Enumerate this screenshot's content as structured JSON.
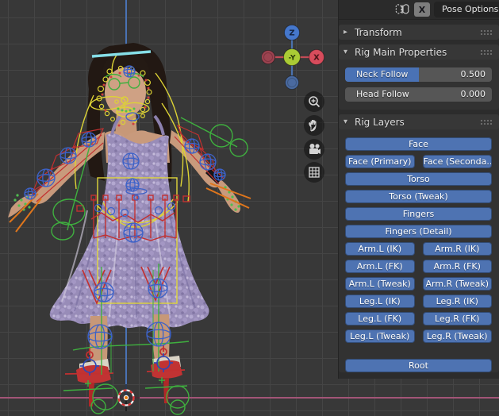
{
  "header": {
    "x_mirror_label": "X",
    "pose_options_label": "Pose Options"
  },
  "sidebar": {
    "panels": [
      {
        "label": "Transform",
        "collapsed": true
      },
      {
        "label": "Rig Main Properties",
        "collapsed": false
      },
      {
        "label": "Rig Layers",
        "collapsed": false
      }
    ],
    "sliders": [
      {
        "label": "Neck Follow",
        "value": "0.500",
        "fill_pct": 50
      },
      {
        "label": "Head Follow",
        "value": "0.000",
        "fill_pct": 0
      }
    ],
    "rig_layers": {
      "rows": [
        [
          "Face"
        ],
        [
          "Face (Primary)",
          "Face (Seconda..."
        ],
        [
          "Torso"
        ],
        [
          "Torso (Tweak)"
        ],
        [
          "Fingers"
        ],
        [
          "Fingers (Detail)"
        ],
        [
          "Arm.L (IK)",
          "Arm.R (IK)"
        ],
        [
          "Arm.L (FK)",
          "Arm.R (FK)"
        ],
        [
          "Arm.L (Tweak)",
          "Arm.R (Tweak)"
        ],
        [
          "Leg.L (IK)",
          "Leg.R (IK)"
        ],
        [
          "Leg.L (FK)",
          "Leg.R (FK)"
        ],
        [
          "Leg.L (Tweak)",
          "Leg.R (Tweak)"
        ]
      ],
      "root_label": "Root"
    }
  },
  "viewport": {
    "axis_gizmo": {
      "z_label": "Z",
      "x_label": "X",
      "center_label": "-Y"
    },
    "nav_buttons": [
      "zoom",
      "pan",
      "camera",
      "perspective-grid"
    ],
    "colors": {
      "background": "#383838",
      "grid": "#454545",
      "z_axis_blue": "#4a72b3",
      "floor_x_line": "#a35577",
      "accent_blue": "#4e73b2",
      "slider_blue": "#4a72b5",
      "rig_yellow": "#ddd335",
      "rig_red": "#c23030",
      "rig_green": "#3fb03f",
      "rig_blue": "#3d62c8",
      "cursor_orange": "#e87d0d",
      "cyan_bar": "#86dfe8"
    }
  }
}
